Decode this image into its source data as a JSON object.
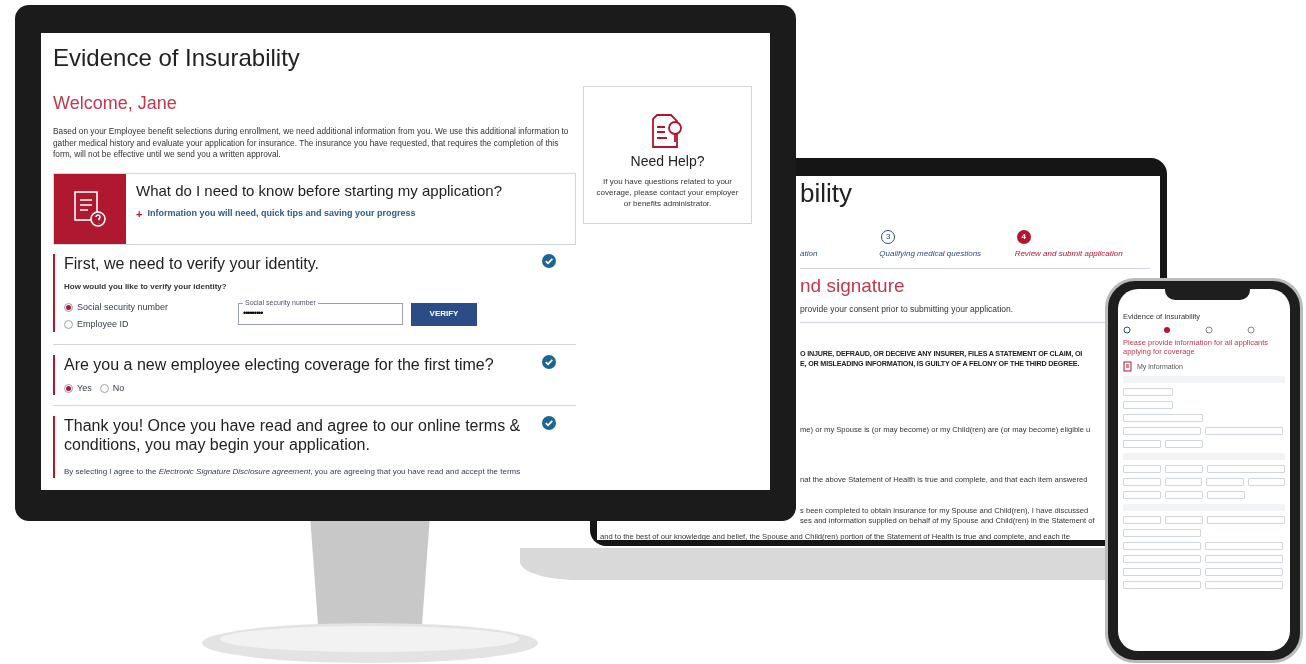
{
  "monitor": {
    "title": "Evidence of Insurability",
    "welcome": "Welcome, Jane",
    "intro": "Based on your Employee benefit selections during enrollment, we need additional information from you. We use this additional information to gather medical history and evaluate your application for insurance. The insurance you have requested, that requires the completion of this form, will not be effective until we send you a written approval.",
    "info_card": {
      "heading": "What do I need to know before starting my application?",
      "link_mark": "+",
      "link": "Information you will need, quick tips and saving your progress"
    },
    "sections": [
      {
        "kind": "identity",
        "heading": "First, we need to verify your identity.",
        "checked": true,
        "question": "How would you like to verify your identity?",
        "options": [
          {
            "label": "Social security number",
            "selected": true
          },
          {
            "label": "Employee ID",
            "selected": false
          }
        ],
        "field": {
          "label": "Social security number",
          "value": "•••••••••"
        },
        "button": "VERIFY"
      },
      {
        "kind": "yesno",
        "heading": "Are you a new employee electing coverage for the first time?",
        "checked": true,
        "options": [
          {
            "label": "Yes",
            "selected": true
          },
          {
            "label": "No",
            "selected": false
          }
        ]
      },
      {
        "kind": "terms",
        "heading": "Thank you! Once you have read and agree to our online terms & conditions, you may begin your application.",
        "checked": true,
        "text": "By selecting I agree to the *Electronic Signature Disclosure agreement*, you are agreeing that you have read and accept the terms"
      }
    ],
    "help": {
      "heading": "Need Help?",
      "text": "If you have questions related to your coverage, please contact your employer or benefits administrator."
    }
  },
  "laptop": {
    "title": "bility",
    "steps": [
      {
        "label": "ation",
        "selected": false
      },
      {
        "number": "3",
        "label": "Qualifying medical questions",
        "selected": false
      },
      {
        "number": "4",
        "label": "Review and submit application",
        "selected": true
      }
    ],
    "heading": "nd signature",
    "subtitle": "provide your consent prior to submitting your application.",
    "warning": [
      "O INJURE, DEFRAUD, OR DECEIVE ANY INSURER, FILES A STATEMENT OF CLAIM, OI",
      "E, OR MISLEADING INFORMATION, IS GUILTY OF A FELONY OF THE THIRD DEGREE."
    ],
    "lines": [
      "me) or my Spouse is (or may become) or my Child(ren) are (or may become) eligible u",
      "nat the above Statement of Health is true and complete, and that each item answered",
      "s been completed to obtain insurance for my Spouse and Child(ren), I have discussed",
      "ses and information supplied on behalf of my Spouse and Child(ren) in the Statement of"
    ],
    "bottom_line": "and to the best of our knowledge and belief, the Spouse and Child(ren) portion of the Statement of Health is true and complete, and each ite"
  },
  "phone": {
    "title": "Evidence of Insurability",
    "subtitle": "Please provide information for all applicants applying for coverage",
    "section": "My information"
  }
}
